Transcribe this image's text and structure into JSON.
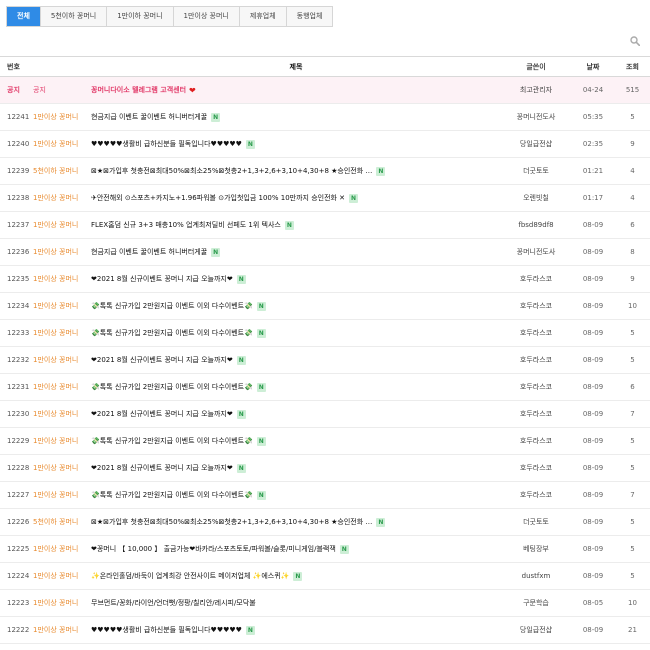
{
  "tabs": [
    {
      "label": "전체",
      "active": true
    },
    {
      "label": "5천이하 꽁머니",
      "active": false
    },
    {
      "label": "1만이하 꽁머니",
      "active": false
    },
    {
      "label": "1만이상 꽁머니",
      "active": false
    },
    {
      "label": "제휴업체",
      "active": false
    },
    {
      "label": "동행업체",
      "active": false
    }
  ],
  "table": {
    "headers": {
      "num": "번호",
      "title": "제목",
      "writer": "글쓴이",
      "date": "날짜",
      "views": "조회"
    },
    "notice": {
      "num": "공지",
      "category": "공지",
      "title": "꽁머니다이소 텔레그램 고객센터",
      "writer": "최고관리자",
      "date": "04-24",
      "views": "515"
    },
    "rows": [
      {
        "num": "12241",
        "category": "1만이상 꽁머니",
        "title": "현금지급 이벤트 꿀이벤트 허니버터게꿀",
        "new": true,
        "writer": "꽁머니전도사",
        "date": "05:35",
        "views": "5"
      },
      {
        "num": "12240",
        "category": "1만이상 꽁머니",
        "title": "♥♥♥♥♥생활비 급하신분들 필독입니다♥♥♥♥♥",
        "new": true,
        "writer": "당일급전샵",
        "date": "02:35",
        "views": "9"
      },
      {
        "num": "12239",
        "category": "5천이하 꽁머니",
        "title": "⊠★⊠가입후 첫충전⊠최대50%⊠최소25%⊠첫충2+1,3+2,6+3,10+4,30+8 ★승인전화 …",
        "new": true,
        "writer": "더굿토토",
        "date": "01:21",
        "views": "4"
      },
      {
        "num": "12238",
        "category": "1만이상 꽁머니",
        "title": "✈안전해외 ⊙스포츠+카지노+1.96파워볼 ⊙가입첫입금 100% 10만까지 승인전화 ✕",
        "new": true,
        "writer": "오렌빗칠",
        "date": "01:17",
        "views": "4"
      },
      {
        "num": "12237",
        "category": "1만이상 꽁머니",
        "title": "FLEX홈덤 신규 3+3 매충10% 업계최저딜비 선페도 1위 텍사스",
        "new": true,
        "writer": "fbsd89df8",
        "date": "08-09",
        "views": "6"
      },
      {
        "num": "12236",
        "category": "1만이상 꽁머니",
        "title": "현금지급 이벤트 꿀이벤트 허니버터게꿀",
        "new": true,
        "writer": "꽁머니전도사",
        "date": "08-09",
        "views": "8"
      },
      {
        "num": "12235",
        "category": "1만이상 꽁머니",
        "title": "❤2021 8월 신규이벤트 꽁머니 지급 오늘까지❤",
        "new": true,
        "writer": "호두라스코",
        "date": "08-09",
        "views": "9"
      },
      {
        "num": "12234",
        "category": "1만이상 꽁머니",
        "title": "💸톡톡 신규가입 2만원지급 이벤트 이외 다수이벤트💸",
        "new": true,
        "writer": "호두라스코",
        "date": "08-09",
        "views": "10"
      },
      {
        "num": "12233",
        "category": "1만이상 꽁머니",
        "title": "💸톡톡 신규가입 2만원지급 이벤트 이외 다수이벤트💸",
        "new": true,
        "writer": "호두라스코",
        "date": "08-09",
        "views": "5"
      },
      {
        "num": "12232",
        "category": "1만이상 꽁머니",
        "title": "❤2021 8월 신규이벤트 꽁머니 지급 오늘까지❤",
        "new": true,
        "writer": "호두라스코",
        "date": "08-09",
        "views": "5"
      },
      {
        "num": "12231",
        "category": "1만이상 꽁머니",
        "title": "💸톡톡 신규가입 2만원지급 이벤트 이외 다수이벤트💸",
        "new": true,
        "writer": "호두라스코",
        "date": "08-09",
        "views": "6"
      },
      {
        "num": "12230",
        "category": "1만이상 꽁머니",
        "title": "❤2021 8월 신규이벤트 꽁머니 지급 오늘까지❤",
        "new": true,
        "writer": "호두라스코",
        "date": "08-09",
        "views": "7"
      },
      {
        "num": "12229",
        "category": "1만이상 꽁머니",
        "title": "💸톡톡 신규가입 2만원지급 이벤트 이외 다수이벤트💸",
        "new": true,
        "writer": "호두라스코",
        "date": "08-09",
        "views": "5"
      },
      {
        "num": "12228",
        "category": "1만이상 꽁머니",
        "title": "❤2021 8월 신규이벤트 꽁머니 지급 오늘까지❤",
        "new": true,
        "writer": "호두라스코",
        "date": "08-09",
        "views": "5"
      },
      {
        "num": "12227",
        "category": "1만이상 꽁머니",
        "title": "💸톡톡 신규가입 2만원지급 이벤트 이외 다수이벤트💸",
        "new": true,
        "writer": "호두라스코",
        "date": "08-09",
        "views": "7"
      },
      {
        "num": "12226",
        "category": "5천이하 꽁머니",
        "title": "⊠★⊠가입후 첫충전⊠최대50%⊠최소25%⊠첫충2+1,3+2,6+3,10+4,30+8 ★승인전화 …",
        "new": true,
        "writer": "더굿토토",
        "date": "08-09",
        "views": "5"
      },
      {
        "num": "12225",
        "category": "1만이상 꽁머니",
        "title": "❤꽁머니 【 10,000 】 출금가능❤바카라/스포츠토토/파워볼/슬롯/미니게임/블랙잭",
        "new": true,
        "writer": "베팅장부",
        "date": "08-09",
        "views": "5"
      },
      {
        "num": "12224",
        "category": "1만이상 꽁머니",
        "title": "✨온라인홀덤/바둑이 업계최강 안전사이트 메이저업체 ✨에스퀴✨",
        "new": true,
        "writer": "dustfxm",
        "date": "08-09",
        "views": "5"
      },
      {
        "num": "12223",
        "category": "1만이상 꽁머니",
        "title": "무브먼트/꽁화/라이언/언더뻣/정팡/칠리안/레시피/모닥불",
        "new": false,
        "writer": "구문학습",
        "date": "08-05",
        "views": "10"
      },
      {
        "num": "12222",
        "category": "1만이상 꽁머니",
        "title": "♥♥♥♥♥생활비 급하신분들 필독입니다♥♥♥♥♥",
        "new": true,
        "writer": "당일급전샵",
        "date": "08-09",
        "views": "21"
      }
    ]
  },
  "badge_label": "N",
  "colors": {
    "accent": "#2f8be6",
    "category": "#e88a2e",
    "notice": "#e23c6a",
    "new_badge": "#2a9b4c"
  }
}
